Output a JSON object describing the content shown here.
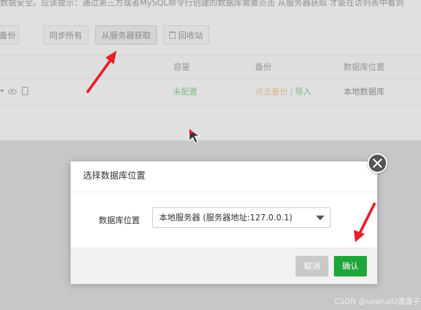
{
  "notice_text": "数据安全。应该提示：通过第三方或者MySQL命令行创建的数据库需要点击 从服务器获取 才能在访列表中看到",
  "toolbar": {
    "backup_label": "备份",
    "sync_all_label": "同步所有",
    "fetch_from_server_label": "从服务器获取",
    "recycle_bin_label": "回收站"
  },
  "table": {
    "headers": {
      "capacity": "容量",
      "backup": "备份",
      "db_location": "数据库位置"
    },
    "row": {
      "capacity": "未配置",
      "backup_action": "点击备份",
      "separator": "|",
      "import_action": "导入",
      "db_location": "本地数据库"
    }
  },
  "modal": {
    "title": "选择数据库位置",
    "field_label": "数据库位置",
    "select_value": "本地服务器 (服务器地址:127.0.0.1)",
    "cancel_label": "取消",
    "confirm_label": "确认"
  },
  "watermark": "CSDN @ueanaIU瀟瀟子",
  "colors": {
    "accent_green": "#20a53a",
    "arrow_red": "#e8202a",
    "orange": "#e6a23c"
  },
  "icons": [
    "trash-icon",
    "eye-icon",
    "doc-icon",
    "close-icon",
    "chevron-down-icon",
    "annotation-arrow-icon",
    "mouse-cursor-icon"
  ]
}
